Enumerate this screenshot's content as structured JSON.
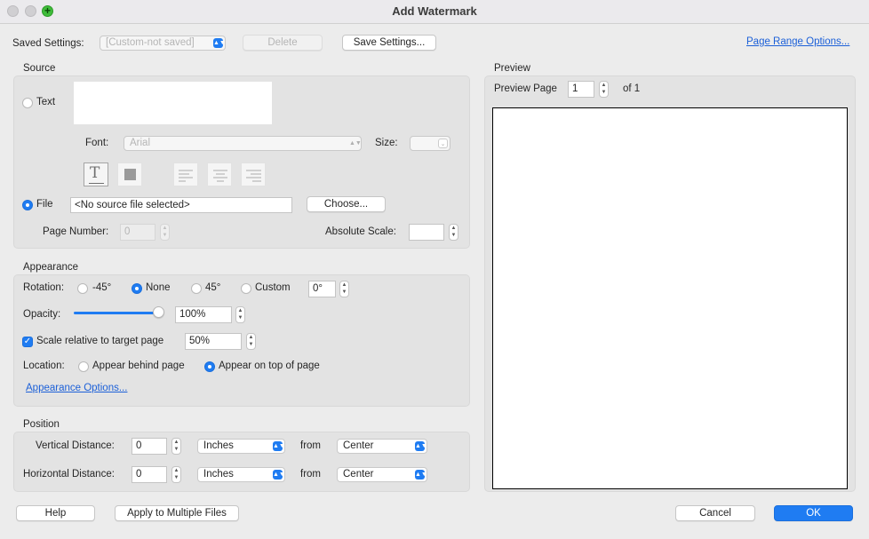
{
  "window": {
    "title": "Add Watermark"
  },
  "top": {
    "saved_settings_label": "Saved Settings:",
    "saved_settings_value": "[Custom-not saved]",
    "delete_label": "Delete",
    "save_settings_label": "Save Settings...",
    "page_range_link": "Page Range Options..."
  },
  "source": {
    "group_label": "Source",
    "text_radio_label": "Text",
    "text_value": "",
    "font_label": "Font:",
    "font_value": "Arial",
    "size_label": "Size:",
    "size_value": "",
    "file_radio_label": "File",
    "file_value": "<No source file selected>",
    "choose_label": "Choose...",
    "page_number_label": "Page Number:",
    "page_number_value": "0",
    "absolute_scale_label": "Absolute Scale:",
    "absolute_scale_value": "",
    "selected_source": "File"
  },
  "appearance": {
    "group_label": "Appearance",
    "rotation_label": "Rotation:",
    "rotation_options": [
      "-45°",
      "None",
      "45°",
      "Custom"
    ],
    "rotation_selected": "None",
    "rotation_custom_value": "0°",
    "opacity_label": "Opacity:",
    "opacity_value": "100%",
    "opacity_fraction": 1.0,
    "scale_checkbox_label": "Scale relative to target page",
    "scale_checked": true,
    "scale_value": "50%",
    "location_label": "Location:",
    "location_options": [
      "Appear behind page",
      "Appear on top of page"
    ],
    "location_selected": "Appear on top of page",
    "options_link": "Appearance Options..."
  },
  "position": {
    "group_label": "Position",
    "vertical_label": "Vertical Distance:",
    "vertical_value": "0",
    "vertical_unit": "Inches",
    "vertical_from_label": "from",
    "vertical_from": "Center",
    "horizontal_label": "Horizontal Distance:",
    "horizontal_value": "0",
    "horizontal_unit": "Inches",
    "horizontal_from_label": "from",
    "horizontal_from": "Center"
  },
  "preview": {
    "group_label": "Preview",
    "page_label": "Preview Page",
    "page_value": "1",
    "of_label": "of 1"
  },
  "footer": {
    "help_label": "Help",
    "apply_multiple_label": "Apply to Multiple Files",
    "cancel_label": "Cancel",
    "ok_label": "OK"
  },
  "colors": {
    "accent": "#1f7cf2",
    "link": "#1c60d8",
    "window_bg": "#ececec",
    "group_bg": "#e3e3e3"
  }
}
